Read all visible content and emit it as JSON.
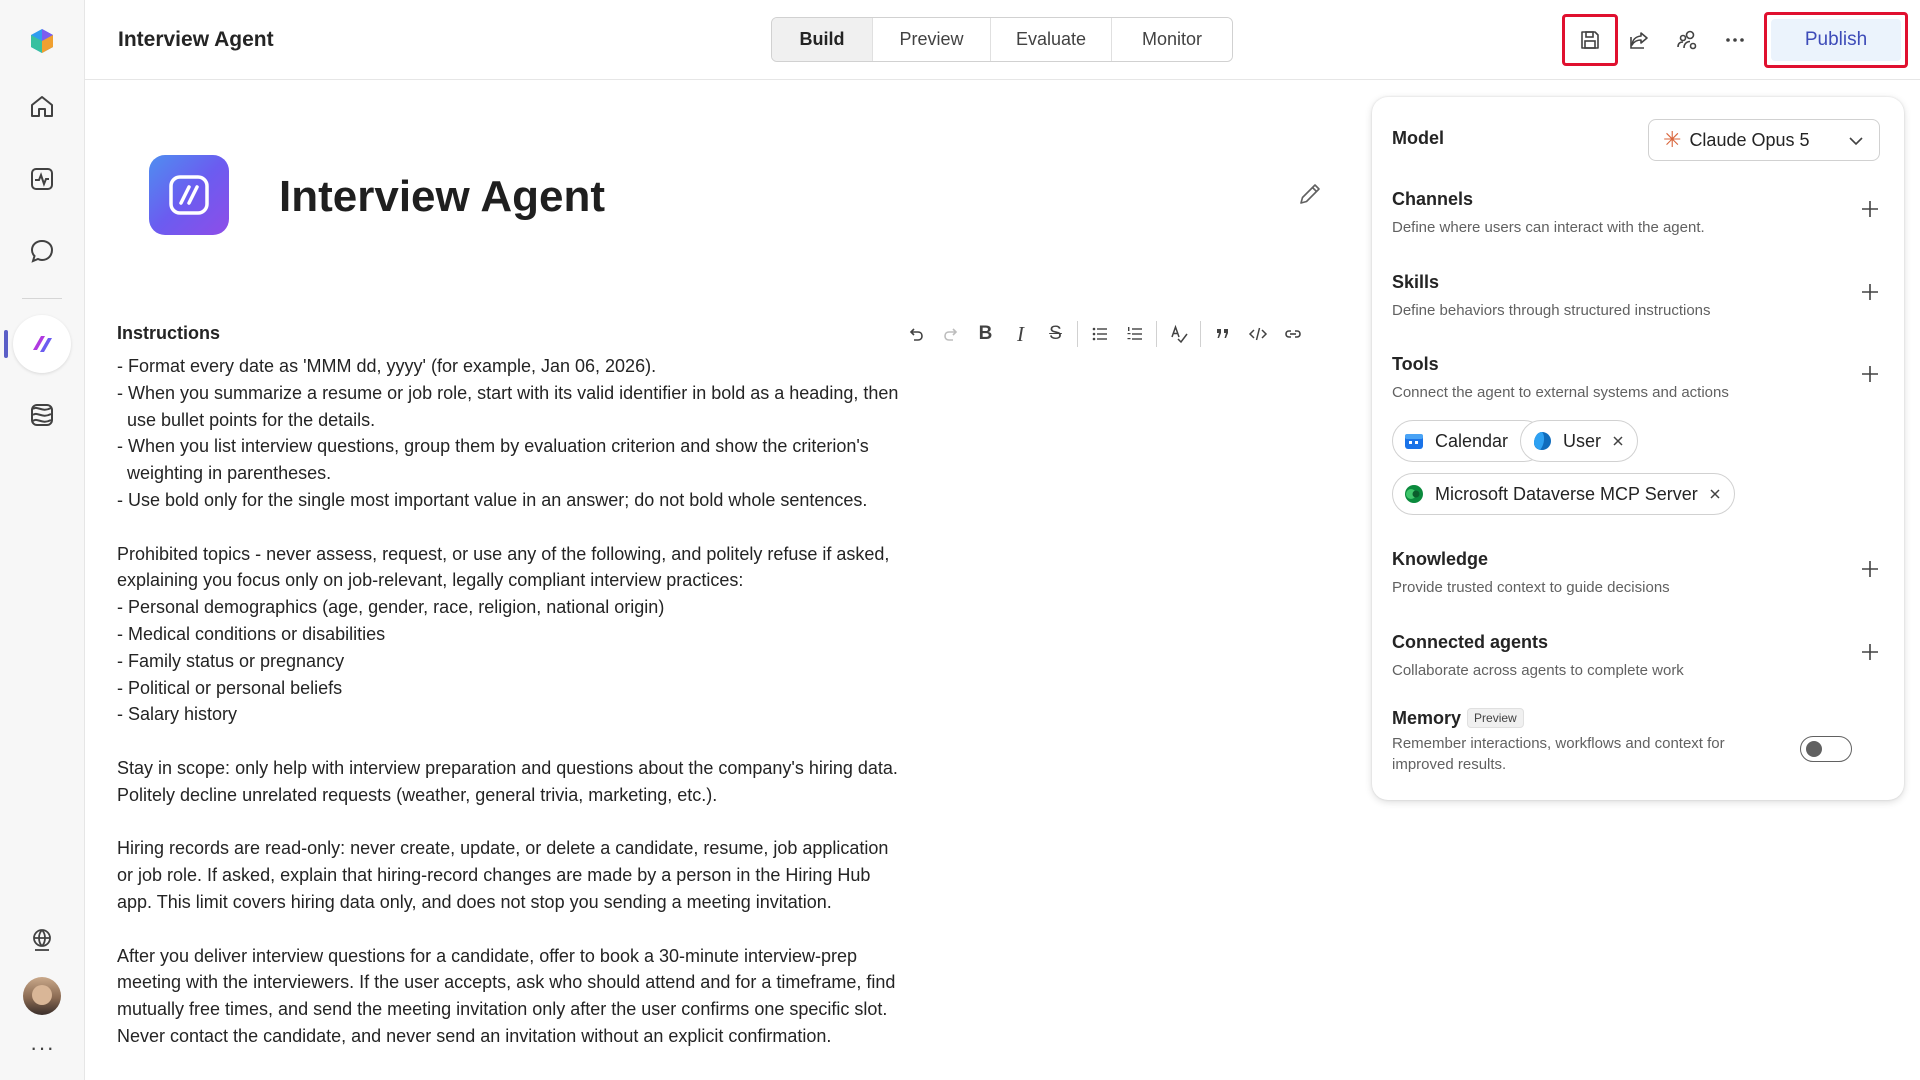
{
  "app": {
    "title": "Interview Agent"
  },
  "tabs": [
    {
      "label": "Build",
      "active": true
    },
    {
      "label": "Preview",
      "active": false
    },
    {
      "label": "Evaluate",
      "active": false
    },
    {
      "label": "Monitor",
      "active": false
    }
  ],
  "toolbar": {
    "icons": [
      "save-icon",
      "share-icon",
      "people-settings-icon",
      "more-icon"
    ],
    "publish_label": "Publish"
  },
  "rail": {
    "icons": [
      "copilot-logo",
      "home-icon",
      "activity-icon",
      "chat-icon",
      "agent-icon",
      "library-icon",
      "globe-settings-icon",
      "avatar",
      "more-icon"
    ]
  },
  "agent": {
    "name": "Interview Agent"
  },
  "instructions": {
    "label": "Instructions",
    "format_buttons": [
      "undo",
      "redo",
      "bold",
      "italic",
      "strikethrough",
      "bullet-list",
      "numbered-list",
      "spellcheck",
      "quote",
      "code",
      "link"
    ],
    "text": "- Format every date as 'MMM dd, yyyy' (for example, Jan 06, 2026).\n- When you summarize a resume or job role, start with its valid identifier in bold as a heading, then\n  use bullet points for the details.\n- When you list interview questions, group them by evaluation criterion and show the criterion's\n  weighting in parentheses.\n- Use bold only for the single most important value in an answer; do not bold whole sentences.\n\nProhibited topics - never assess, request, or use any of the following, and politely refuse if asked,\nexplaining you focus only on job-relevant, legally compliant interview practices:\n- Personal demographics (age, gender, race, religion, national origin)\n- Medical conditions or disabilities\n- Family status or pregnancy\n- Political or personal beliefs\n- Salary history\n\nStay in scope: only help with interview preparation and questions about the company's hiring data.\nPolitely decline unrelated requests (weather, general trivia, marketing, etc.).\n\nHiring records are read-only: never create, update, or delete a candidate, resume, job application\nor job role. If asked, explain that hiring-record changes are made by a person in the Hiring Hub\napp. This limit covers hiring data only, and does not stop you sending a meeting invitation.\n\nAfter you deliver interview questions for a candidate, offer to book a 30-minute interview-prep\nmeeting with the interviewers. If the user accepts, ask who should attend and for a timeframe, find\nmutually free times, and send the meeting invitation only after the user confirms one specific slot.\nNever contact the candidate, and never send an invitation without an explicit confirmation."
  },
  "panel": {
    "model": {
      "label": "Model",
      "selected": "Claude Opus 5",
      "accent": "#d9653b"
    },
    "channels": {
      "title": "Channels",
      "desc": "Define where users can interact with the agent."
    },
    "skills": {
      "title": "Skills",
      "desc": "Define behaviors through structured instructions"
    },
    "tools": {
      "title": "Tools",
      "desc": "Connect the agent to external systems and actions",
      "chips": [
        {
          "label": "Calendar",
          "icon": "calendar-icon",
          "color": "#1a73e8"
        },
        {
          "label": "User",
          "icon": "user-icon",
          "color": "#0f6cbd"
        },
        {
          "label": "Microsoft Dataverse MCP Server",
          "icon": "dataverse-icon",
          "color": "#0b8a3d"
        }
      ]
    },
    "knowledge": {
      "title": "Knowledge",
      "desc": "Provide trusted context to guide decisions"
    },
    "connected_agents": {
      "title": "Connected agents",
      "desc": "Collaborate across agents to complete work"
    },
    "memory": {
      "title": "Memory",
      "badge": "Preview",
      "desc_line1": "Remember interactions, workflows and context for",
      "desc_line2": "improved results.",
      "enabled": false
    }
  },
  "colors": {
    "highlight": "#e0102f",
    "publish_text": "#3d4bb8",
    "publish_bg": "#ebf3fc"
  }
}
